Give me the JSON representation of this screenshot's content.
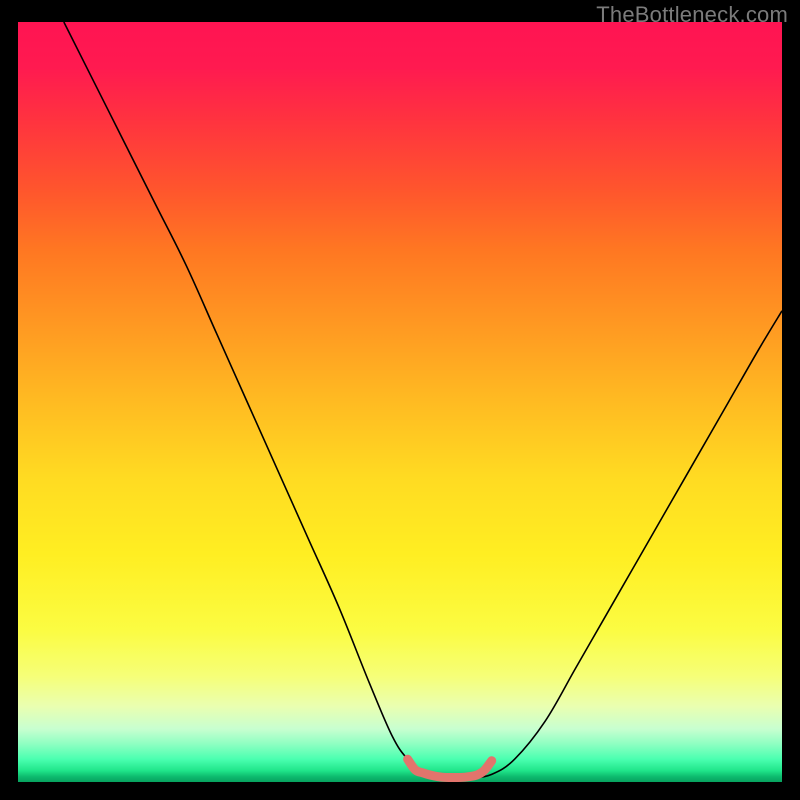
{
  "watermark": "TheBottleneck.com",
  "chart_data": {
    "type": "line",
    "title": "",
    "xlabel": "",
    "ylabel": "",
    "xlim": [
      0,
      100
    ],
    "ylim": [
      0,
      100
    ],
    "grid": false,
    "legend": false,
    "background_gradient": {
      "direction": "vertical",
      "stops": [
        {
          "pos": 0,
          "color": "#ff1452"
        },
        {
          "pos": 50,
          "color": "#ffdb22"
        },
        {
          "pos": 90,
          "color": "#eaffb0"
        },
        {
          "pos": 100,
          "color": "#08a25e"
        }
      ]
    },
    "series": [
      {
        "name": "bottleneck-curve",
        "stroke": "#000000",
        "stroke_width": 1.6,
        "x": [
          6,
          10,
          14,
          18,
          22,
          26,
          30,
          34,
          38,
          42,
          46,
          49,
          51,
          53,
          55,
          57,
          59.5,
          62,
          65,
          69,
          73,
          77,
          81,
          85,
          89,
          93,
          97,
          100
        ],
        "y": [
          100,
          92,
          84,
          76,
          68,
          59,
          50,
          41,
          32,
          23,
          13,
          6,
          3,
          1.3,
          0.7,
          0.6,
          0.6,
          1.0,
          3,
          8,
          15,
          22,
          29,
          36,
          43,
          50,
          57,
          62
        ]
      },
      {
        "name": "optimal-zone",
        "stroke": "#e2746c",
        "stroke_width": 9,
        "linecap": "round",
        "x": [
          51,
          52,
          53,
          54,
          55,
          56,
          57,
          58,
          59,
          60,
          61,
          62
        ],
        "y": [
          3.0,
          1.6,
          1.2,
          0.9,
          0.7,
          0.6,
          0.6,
          0.6,
          0.7,
          0.9,
          1.5,
          2.8
        ]
      }
    ]
  }
}
